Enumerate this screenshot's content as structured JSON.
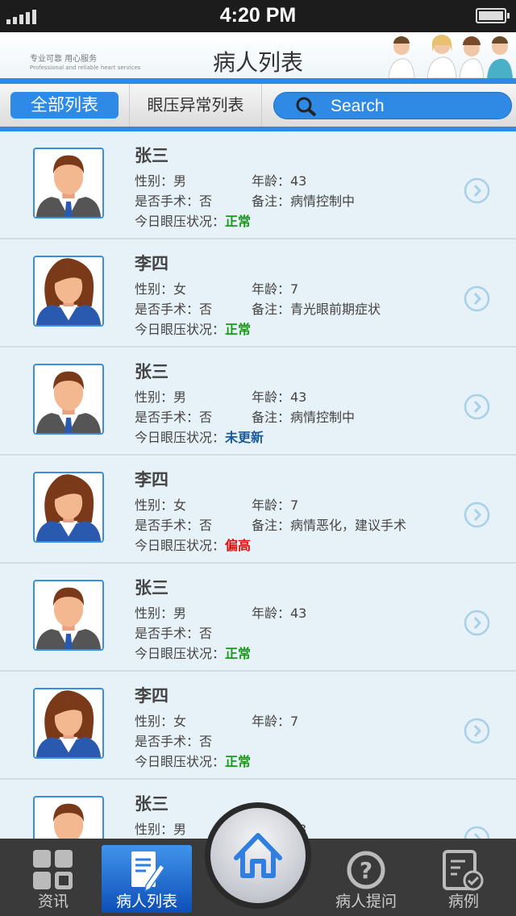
{
  "status_bar": {
    "time": "4:20 PM"
  },
  "header": {
    "title": "病人列表",
    "slogan": "专业可靠 用心服务",
    "slogan_en": "Professional and reliable heart services"
  },
  "tabs": {
    "all": "全部列表",
    "abnormal": "眼压异常列表",
    "search_placeholder": "Search"
  },
  "colors": {
    "accent": "#2f8ae6",
    "normal": "#1a9a1a",
    "not_updated": "#1a5a9a",
    "high": "#e01010"
  },
  "patients": [
    {
      "name": "张三",
      "gender_label": "性别：男",
      "age_label": "年龄：43",
      "surgery_label": "是否手术：否",
      "note_label": "备注：病情控制中",
      "iop_label": "今日眼压状况：",
      "iop_status": "正常",
      "status_type": "normal",
      "sex": "m"
    },
    {
      "name": "李四",
      "gender_label": "性别：女",
      "age_label": "年龄：7",
      "surgery_label": "是否手术：否",
      "note_label": "备注：青光眼前期症状",
      "iop_label": "今日眼压状况：",
      "iop_status": "正常",
      "status_type": "normal",
      "sex": "f"
    },
    {
      "name": "张三",
      "gender_label": "性别：男",
      "age_label": "年龄：43",
      "surgery_label": "是否手术：否",
      "note_label": "备注：病情控制中",
      "iop_label": "今日眼压状况：",
      "iop_status": "未更新",
      "status_type": "not_updated",
      "sex": "m"
    },
    {
      "name": "李四",
      "gender_label": "性别：女",
      "age_label": "年龄：7",
      "surgery_label": "是否手术：否",
      "note_label": "备注：病情恶化，建议手术",
      "iop_label": "今日眼压状况：",
      "iop_status": "偏高",
      "status_type": "high",
      "sex": "f"
    },
    {
      "name": "张三",
      "gender_label": "性别：男",
      "age_label": "年龄：43",
      "surgery_label": "是否手术：否",
      "note_label": "",
      "iop_label": "今日眼压状况：",
      "iop_status": "正常",
      "status_type": "normal",
      "sex": "m"
    },
    {
      "name": "李四",
      "gender_label": "性别：女",
      "age_label": "年龄：7",
      "surgery_label": "是否手术：否",
      "note_label": "",
      "iop_label": "今日眼压状况：",
      "iop_status": "正常",
      "status_type": "normal",
      "sex": "f"
    },
    {
      "name": "张三",
      "gender_label": "性别：男",
      "age_label": "年龄：43",
      "surgery_label": "",
      "note_label": "",
      "iop_label": "",
      "iop_status": "",
      "status_type": "normal",
      "sex": "m"
    }
  ],
  "nav": {
    "news": "资讯",
    "patients": "病人列表",
    "questions": "病人提问",
    "cases": "病例"
  }
}
